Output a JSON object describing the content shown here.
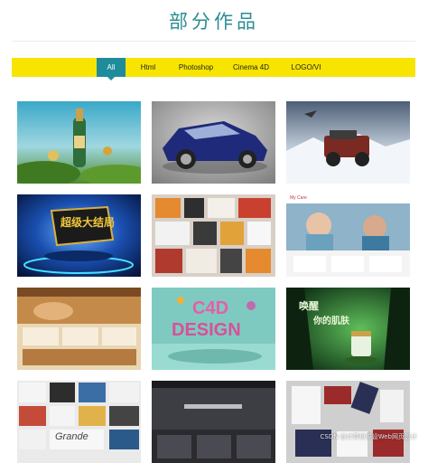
{
  "page": {
    "title": "部分作品"
  },
  "nav": {
    "items": [
      {
        "label": "All",
        "active": true
      },
      {
        "label": "Html",
        "active": false
      },
      {
        "label": "Photoshop",
        "active": false
      },
      {
        "label": "Cinema 4D",
        "active": false
      },
      {
        "label": "LOGO/VI",
        "active": false
      }
    ],
    "colors": {
      "bar": "#f7e400",
      "active": "#1e8c9a"
    }
  },
  "gallery": {
    "items": [
      {
        "name": "bottle-poster-image",
        "alt": "bottle poster"
      },
      {
        "name": "blue-car-image",
        "alt": "blue car"
      },
      {
        "name": "jeep-snow-image",
        "alt": "jeep in snow"
      },
      {
        "name": "stage-logo-image",
        "alt": "stage logo",
        "label": "超级大结局"
      },
      {
        "name": "vi-collage-image",
        "alt": "VI collage"
      },
      {
        "name": "website-screenshot-image",
        "alt": "website screenshot",
        "label": "My Care"
      },
      {
        "name": "web-layout-image",
        "alt": "web layout"
      },
      {
        "name": "c4d-design-image",
        "alt": "C4D design",
        "label": "C4D",
        "label2": "DESIGN"
      },
      {
        "name": "forest-product-image",
        "alt": "forest cosmetics",
        "label": "唤醒",
        "label2": "你的肌肤"
      },
      {
        "name": "logo-collage-image",
        "alt": "logo collage",
        "label": "Grande"
      },
      {
        "name": "dark-website-image",
        "alt": "dark website"
      },
      {
        "name": "stationery-vi-image",
        "alt": "stationery VI"
      }
    ]
  },
  "watermark": "CSDN @计算机毕设Web网页设计"
}
